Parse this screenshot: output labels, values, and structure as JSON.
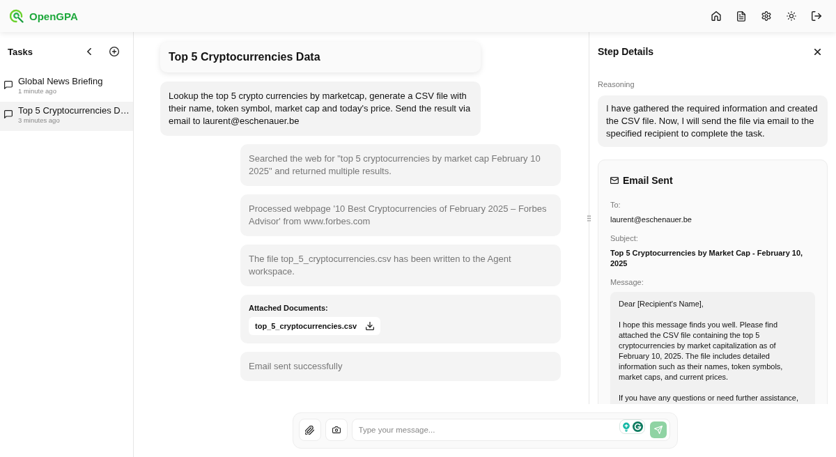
{
  "header": {
    "brand": "OpenGPA"
  },
  "sidebar": {
    "title": "Tasks",
    "items": [
      {
        "title": "Global News Briefing",
        "time": "1 minute ago",
        "selected": false
      },
      {
        "title": "Top 5 Cryptocurrencies D…",
        "time": "3 minutes ago",
        "selected": true
      }
    ]
  },
  "chat": {
    "title": "Top 5 Cryptocurrencies Data",
    "user_message": "Lookup the top 5 crypto currencies by marketcap, generate a CSV file with their name, token symbol, market cap and today's price. Send the result via email to laurent@eschenauer.be",
    "steps": [
      {
        "kind": "text",
        "text": "Searched the web for \"top 5 cryptocurrencies by market cap February 10 2025\" and returned multiple results."
      },
      {
        "kind": "text",
        "text": "Processed webpage '10 Best Cryptocurrencies of February 2025 – Forbes Advisor' from www.forbes.com"
      },
      {
        "kind": "text",
        "text": "The file top_5_cryptocurrencies.csv has been written to the Agent workspace."
      },
      {
        "kind": "attachments",
        "label": "Attached Documents:",
        "files": [
          "top_5_cryptocurrencies.csv"
        ]
      },
      {
        "kind": "text",
        "text": "Email sent successfully"
      }
    ]
  },
  "composer": {
    "placeholder": "Type your message..."
  },
  "step_details": {
    "title": "Step Details",
    "reasoning_label": "Reasoning",
    "reasoning": "I have gathered the required information and created the CSV file. Now, I will send the file via email to the specified recipient to complete the task.",
    "email": {
      "title": "Email Sent",
      "to_label": "To:",
      "to": "laurent@eschenauer.be",
      "subject_label": "Subject:",
      "subject": "Top 5 Cryptocurrencies by Market Cap - February 10, 2025",
      "message_label": "Message:",
      "message": "Dear [Recipient's Name],\n\nI hope this message finds you well. Please find attached the CSV file containing the top 5 cryptocurrencies by market capitalization as of February 10, 2025. The file includes detailed information such as their names, token symbols, market caps, and current prices.\n\nIf you have any questions or need further assistance,"
    }
  }
}
